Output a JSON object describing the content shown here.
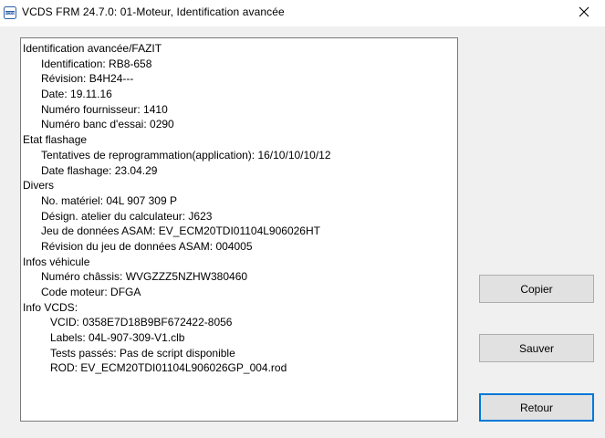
{
  "window": {
    "title": "VCDS FRM 24.7.0: 01-Moteur,  Identification avancée",
    "app_icon": "vcds-app-icon",
    "close_icon": "close-icon"
  },
  "info_lines": [
    {
      "text": "Identification avancée/FAZIT",
      "level": 0
    },
    {
      "text": "Identification: RB8-658",
      "level": 1
    },
    {
      "text": "Révision: B4H24---",
      "level": 1
    },
    {
      "text": "Date: 19.11.16",
      "level": 1
    },
    {
      "text": "Numéro fournisseur: 1410",
      "level": 1
    },
    {
      "text": "Numéro banc d'essai: 0290",
      "level": 1
    },
    {
      "text": "Etat flashage",
      "level": 0
    },
    {
      "text": "Tentatives de reprogrammation(application): 16/10/10/10/12",
      "level": 1
    },
    {
      "text": "Date flashage: 23.04.29",
      "level": 1
    },
    {
      "text": "Divers",
      "level": 0
    },
    {
      "text": "No. matériel: 04L 907 309 P",
      "level": 1
    },
    {
      "text": "Désign. atelier du calculateur: J623",
      "level": 1
    },
    {
      "text": "Jeu de données ASAM: EV_ECM20TDI01104L906026HT",
      "level": 1
    },
    {
      "text": "Révision du jeu de données ASAM: 004005",
      "level": 1
    },
    {
      "text": "Infos véhicule",
      "level": 0
    },
    {
      "text": "Numéro châssis: WVGZZZ5NZHW380460",
      "level": 1
    },
    {
      "text": "Code moteur: DFGA",
      "level": 1
    },
    {
      "text": "Info VCDS:",
      "level": 0
    },
    {
      "text": "VCID: 0358E7D18B9BF672422-8056",
      "level": 2
    },
    {
      "text": "Labels: 04L-907-309-V1.clb",
      "level": 2
    },
    {
      "text": "Tests passés: Pas de script disponible",
      "level": 2
    },
    {
      "text": "ROD: EV_ECM20TDI01104L906026GP_004.rod",
      "level": 2
    }
  ],
  "buttons": {
    "copy_label": "Copier",
    "save_label": "Sauver",
    "back_label": "Retour"
  },
  "colors": {
    "default_button_border": "#0078d7",
    "window_background": "#f0f0f0"
  }
}
